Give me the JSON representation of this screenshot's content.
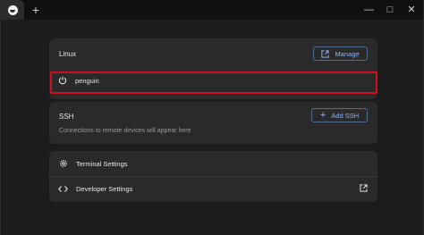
{
  "titlebar": {
    "new_tab": "+",
    "controls": [
      "—",
      "□",
      "✕"
    ]
  },
  "linux": {
    "title": "Linux",
    "manage_label": "Manage",
    "container_name": "penguin"
  },
  "ssh": {
    "title": "SSH",
    "add_label": "Add SSH",
    "empty_text": "Connections to remote devices will appear here"
  },
  "settings": {
    "terminal_label": "Terminal Settings",
    "developer_label": "Developer Settings"
  },
  "colors": {
    "accent": "#8ab4f8",
    "highlight": "#d0101a",
    "card": "#2a2a2a",
    "background": "#1c1c1c"
  }
}
